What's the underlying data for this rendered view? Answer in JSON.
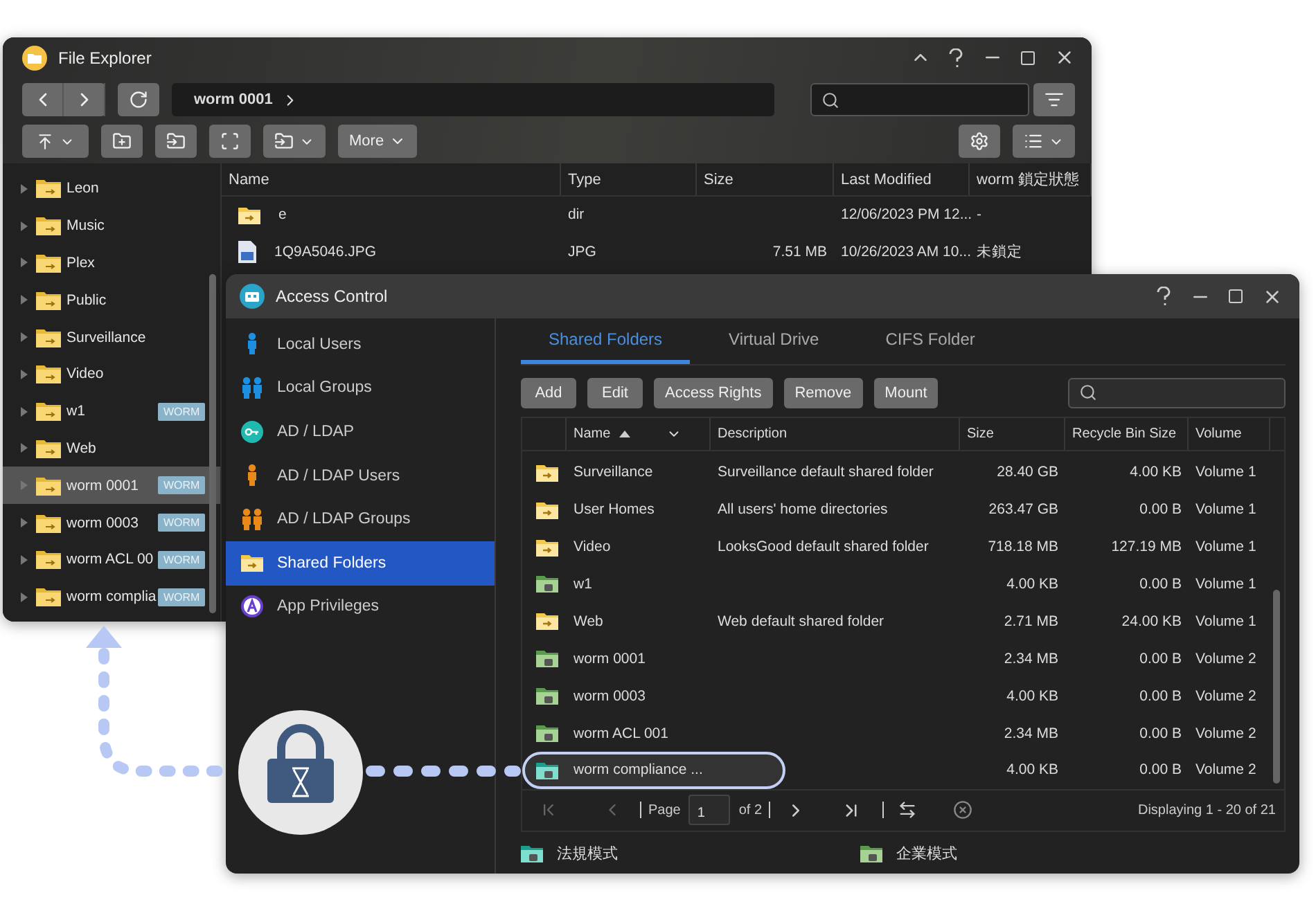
{
  "file_explorer": {
    "title": "File Explorer",
    "path": "worm 0001",
    "more": "More",
    "columns": [
      "Name",
      "Type",
      "Size",
      "Last Modified",
      "worm 鎖定狀態"
    ],
    "files": [
      {
        "kind": "folder",
        "name": "e",
        "type": "dir",
        "modified": "12/06/2023 PM 12...",
        "worm_status": "-"
      },
      {
        "kind": "image",
        "name": "1Q9A5046.JPG",
        "type": "JPG",
        "size": "7.51 MB",
        "modified": "10/26/2023 AM 10...",
        "worm_status": "未鎖定"
      }
    ],
    "tree": [
      {
        "label": "Leon",
        "selected": false
      },
      {
        "label": "Music",
        "selected": false
      },
      {
        "label": "Plex",
        "selected": false
      },
      {
        "label": "Public",
        "selected": false
      },
      {
        "label": "Surveillance",
        "selected": false
      },
      {
        "label": "Video",
        "selected": false
      },
      {
        "label": "w1",
        "badge": "WORM",
        "selected": false
      },
      {
        "label": "Web",
        "selected": false
      },
      {
        "label": "worm 0001",
        "badge": "WORM",
        "selected": true
      },
      {
        "label": "worm 0003",
        "badge": "WORM",
        "selected": false
      },
      {
        "label": "worm ACL 00",
        "badge": "WORM",
        "selected": false
      },
      {
        "label": "worm complia",
        "badge": "WORM",
        "selected": false
      }
    ]
  },
  "access_control": {
    "title": "Access Control",
    "sidebar": [
      {
        "kind": "user",
        "label": "Local Users",
        "selected": false
      },
      {
        "kind": "group",
        "label": "Local Groups",
        "selected": false
      },
      {
        "kind": "key",
        "label": "AD / LDAP",
        "selected": false
      },
      {
        "kind": "ad-user",
        "label": "AD / LDAP Users",
        "selected": false
      },
      {
        "kind": "ad-group",
        "label": "AD / LDAP Groups",
        "selected": false
      },
      {
        "kind": "folder",
        "label": "Shared Folders",
        "selected": true
      },
      {
        "kind": "app",
        "label": "App Privileges",
        "selected": false
      }
    ],
    "tabs": [
      {
        "label": "Shared Folders",
        "selected": true
      },
      {
        "label": "Virtual Drive",
        "selected": false
      },
      {
        "label": "CIFS Folder",
        "selected": false
      }
    ],
    "buttons": [
      "Add",
      "Edit",
      "Access Rights",
      "Remove",
      "Mount"
    ],
    "columns": [
      {
        "label": "Name",
        "sort_ascending": true
      },
      {
        "label": "Description",
        "sort_ascending": false
      },
      {
        "label": "Size",
        "sort_ascending": false
      },
      {
        "label": "Recycle Bin Size",
        "sort_ascending": false
      },
      {
        "label": "Volume",
        "sort_ascending": false
      }
    ],
    "rows": [
      {
        "kind": "shared",
        "name": "Surveillance",
        "description": "Surveillance default shared folder",
        "size": "28.40 GB",
        "recycle_bin_size": "4.00 KB",
        "volume": "Volume 1",
        "highlighted": false
      },
      {
        "kind": "shared",
        "name": "User Homes",
        "description": "All users' home directories",
        "size": "263.47 GB",
        "recycle_bin_size": "0.00 B",
        "volume": "Volume 1",
        "highlighted": false
      },
      {
        "kind": "shared",
        "name": "Video",
        "description": "LooksGood default shared folder",
        "size": "718.18 MB",
        "recycle_bin_size": "127.19 MB",
        "volume": "Volume 1",
        "highlighted": false
      },
      {
        "kind": "enterprise",
        "name": "w1",
        "description": "",
        "size": "4.00 KB",
        "recycle_bin_size": "0.00 B",
        "volume": "Volume 1",
        "highlighted": false
      },
      {
        "kind": "shared",
        "name": "Web",
        "description": "Web default shared folder",
        "size": "2.71 MB",
        "recycle_bin_size": "24.00 KB",
        "volume": "Volume 1",
        "highlighted": false
      },
      {
        "kind": "enterprise",
        "name": "worm 0001",
        "description": "",
        "size": "2.34 MB",
        "recycle_bin_size": "0.00 B",
        "volume": "Volume 2",
        "highlighted": false
      },
      {
        "kind": "enterprise",
        "name": "worm 0003",
        "description": "",
        "size": "4.00 KB",
        "recycle_bin_size": "0.00 B",
        "volume": "Volume 2",
        "highlighted": false
      },
      {
        "kind": "enterprise",
        "name": "worm ACL 001",
        "description": "",
        "size": "2.34 MB",
        "recycle_bin_size": "0.00 B",
        "volume": "Volume 2",
        "highlighted": false
      },
      {
        "kind": "compliance",
        "name": "worm compliance ...",
        "description": "",
        "size": "4.00 KB",
        "recycle_bin_size": "0.00 B",
        "volume": "Volume 2",
        "highlighted": true
      }
    ],
    "pagination": {
      "page_label": "Page",
      "page": "1",
      "of": "of 2",
      "displaying": "Displaying 1 - 20 of 21"
    },
    "legend": [
      {
        "kind": "compliance",
        "label": "法規模式"
      },
      {
        "kind": "enterprise",
        "label": "企業模式"
      }
    ]
  }
}
